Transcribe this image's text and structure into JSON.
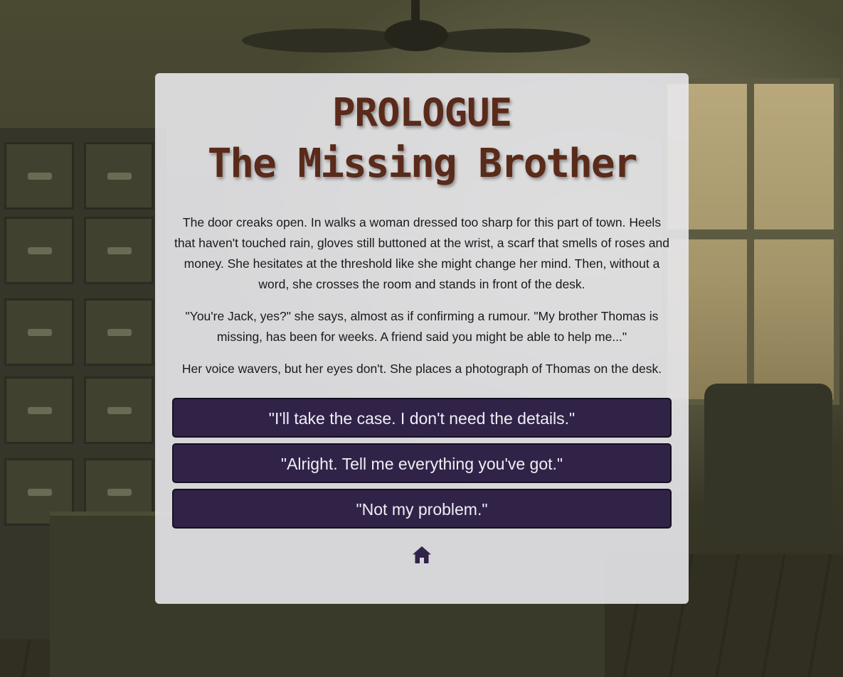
{
  "title": {
    "line1": "PROLOGUE",
    "line2": "The Missing Brother"
  },
  "story": {
    "paragraphs": [
      "The door creaks open. In walks a woman dressed too sharp for this part of town. Heels that haven't touched rain, gloves still buttoned at the wrist, a scarf that smells of roses and money. She hesitates at the threshold like she might change her mind. Then, without a word, she crosses the room and stands in front of the desk.",
      "\"You're Jack, yes?\" she says, almost as if confirming a rumour. \"My brother Thomas is missing, has been for weeks. A friend said you might be able to help me...\"",
      "Her voice wavers, but her eyes don't. She places a photograph of Thomas on the desk."
    ]
  },
  "choices": [
    {
      "label": "\"I'll take the case. I don't need the details.\""
    },
    {
      "label": "\"Alright. Tell me everything you've got.\""
    },
    {
      "label": "\"Not my problem.\""
    }
  ],
  "home": {
    "icon": "home-icon"
  },
  "colors": {
    "title": "#5a2a1a",
    "button": "#312348",
    "panel": "#e8e8ec"
  }
}
